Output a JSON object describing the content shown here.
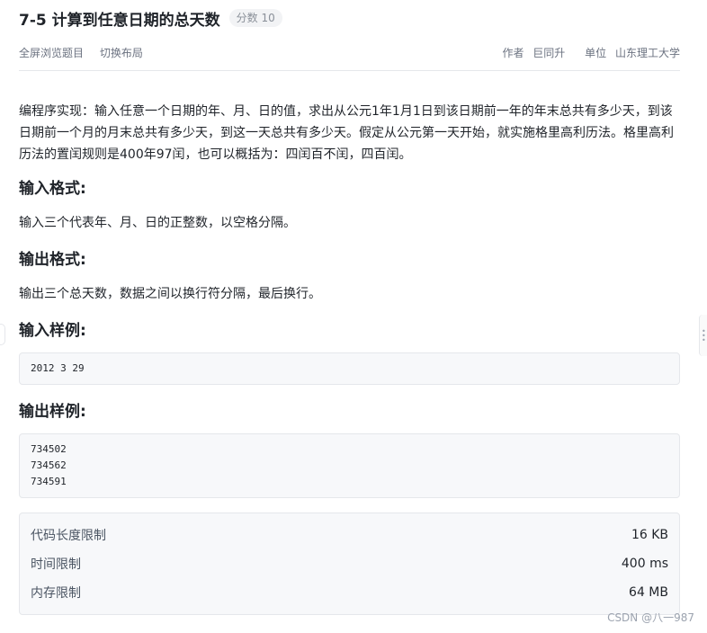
{
  "problem": {
    "title": "7-5 计算到任意日期的总天数",
    "score": "分数 10"
  },
  "meta": {
    "fullscreen": "全屏浏览题目",
    "switch_layout": "切换布局",
    "author_label": "作者",
    "author": "巨同升",
    "unit_label": "单位",
    "unit": "山东理工大学"
  },
  "body": {
    "description": "编程序实现：输入任意一个日期的年、月、日的值，求出从公元1年1月1日到该日期前一年的年末总共有多少天，到该日期前一个月的月末总共有多少天，到这一天总共有多少天。假定从公元第一天开始，就实施格里高利历法。格里高利历法的置闰规则是400年97闰，也可以概括为：四闰百不闰，四百闰。",
    "input_format_title": "输入格式:",
    "input_format": "输入三个代表年、月、日的正整数，以空格分隔。",
    "output_format_title": "输出格式:",
    "output_format": "输出三个总天数，数据之间以换行符分隔，最后换行。",
    "input_sample_title": "输入样例:",
    "input_sample": "2012 3 29",
    "output_sample_title": "输出样例:",
    "output_sample": "734502\n734562\n734591"
  },
  "limits": [
    {
      "label": "代码长度限制",
      "value": "16 KB"
    },
    {
      "label": "时间限制",
      "value": "400 ms"
    },
    {
      "label": "内存限制",
      "value": "64 MB"
    }
  ],
  "watermark": "CSDN @八一987"
}
